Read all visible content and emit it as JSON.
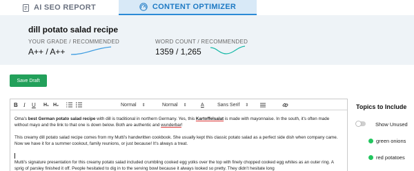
{
  "tabs": {
    "seo_report": "AI SEO REPORT",
    "content_optimizer": "CONTENT OPTIMIZER"
  },
  "header": {
    "keyword": "dill potato salad recipe",
    "grade_label": "YOUR GRADE / RECOMMENDED",
    "grade_value": "A++ / A++",
    "wordcount_label": "WORD COUNT / RECOMMENDED",
    "wordcount_value": "1359 / 1,265"
  },
  "save_label": "Save Draft",
  "toolbar": {
    "bold": "B",
    "italic": "I",
    "underline": "U",
    "h1": "H₁",
    "h2": "H₂",
    "size1": "Normal",
    "size2": "Normal",
    "color": "A",
    "font": "Sans Serif"
  },
  "content": {
    "p1_a": "Oma's ",
    "p1_b": "best German potato salad recipe",
    "p1_c": " with dill is traditional in northern Germany. Yes, this ",
    "p1_d": "Kartoffelsalat",
    "p1_e": " is made with mayonnaise. In the south, it's often made without mayo and the link to that one is down below. Both are authentic and ",
    "p1_f": "wunderbar",
    "p1_g": "!",
    "p2": "This creamy dill potato salad recipe comes from my Mutti's handwritten cookbook. She usually kept this classic potato salad as a perfect side dish when company came. Now we have it for a summer cookout, family reunions, or just because! It's always a treat.",
    "p3": "Mutti's signature presentation for this creamy potato salad included crumbling cooked egg yolks over the top with finely chopped cooked egg whites as an outer ring. A sprig of parsley finished it off. People hesitated to dig in to the serving bowl because it always looked so pretty. They didn't hesitate long"
  },
  "topics": {
    "title": "Topics to Include",
    "show_unused": "Show Unused",
    "items": [
      "green onions",
      "red potatoes"
    ]
  },
  "colors": {
    "accent": "#2b8ad6",
    "save_button": "#22a05a",
    "topic_dot": "#22c55e"
  }
}
